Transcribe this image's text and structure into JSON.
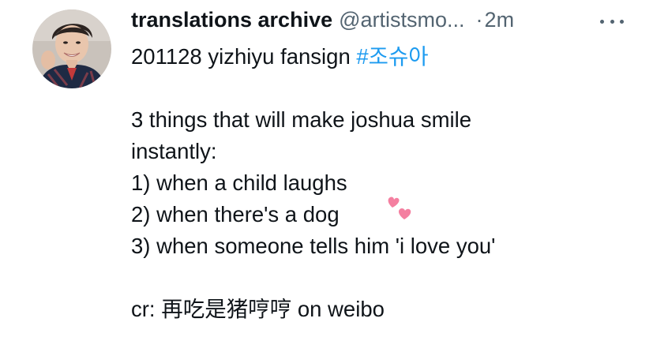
{
  "tweet": {
    "display_name": "translations archive",
    "handle": "@artistsmo...",
    "separator": "·",
    "timestamp": "2m",
    "avatar_icon": "profile-photo-avatar",
    "more_icon": "more-horizontal-icon",
    "headline": "201128 yizhiyu fansign",
    "hashtag": "#조슈아",
    "lines": [
      "3 things that will make joshua smile",
      "instantly:",
      "1) when a child laughs",
      "2) when there's a dog",
      "3) when someone tells him 'i love you'"
    ],
    "credit": "cr: 再吃是猪哼哼 on weibo",
    "emoji_icon": "two-hearts-icon",
    "colors": {
      "text": "#0f1419",
      "secondary": "#536471",
      "link": "#1d9bf0",
      "hearts": "#f47fa0"
    }
  }
}
